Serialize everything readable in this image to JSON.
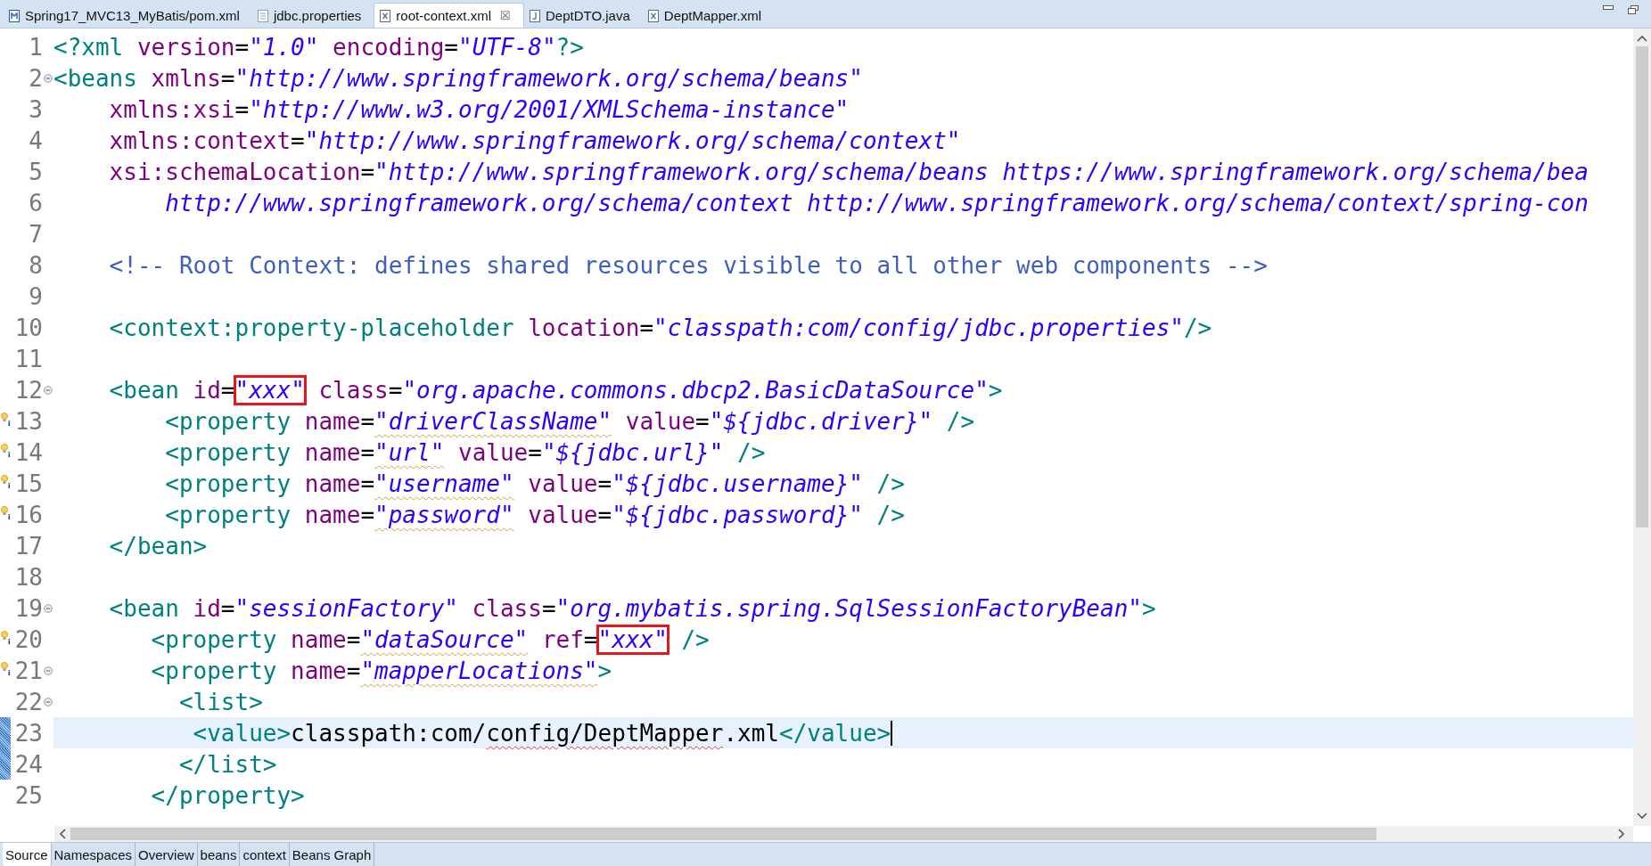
{
  "editor_tabs": [
    {
      "label": "Spring17_MVC13_MyBatis/pom.xml",
      "kind": "maven",
      "selected": false
    },
    {
      "label": "jdbc.properties",
      "kind": "text",
      "selected": false
    },
    {
      "label": "root-context.xml",
      "kind": "xml",
      "selected": true,
      "close": "☒"
    },
    {
      "label": "DeptDTO.java",
      "kind": "java",
      "selected": false
    },
    {
      "label": "DeptMapper.xml",
      "kind": "xml",
      "selected": false
    }
  ],
  "lines": [
    {
      "number": "1",
      "tokens": [
        {
          "kind": "tag",
          "text": "<?xml "
        },
        {
          "kind": "attr",
          "text": "version"
        },
        {
          "kind": "eq",
          "text": "="
        },
        {
          "kind": "value",
          "text": "\"1.0\""
        },
        {
          "kind": "attr",
          "text": " encoding"
        },
        {
          "kind": "eq",
          "text": "="
        },
        {
          "kind": "value",
          "text": "\"UTF-8\""
        },
        {
          "kind": "tag",
          "text": "?>"
        }
      ]
    },
    {
      "number": "2",
      "fold": true,
      "tokens": [
        {
          "kind": "tag",
          "text": "<beans "
        },
        {
          "kind": "attr",
          "text": "xmlns"
        },
        {
          "kind": "eq",
          "text": "="
        },
        {
          "kind": "value",
          "text": "\"http://www.springframework.org/schema/beans\""
        }
      ]
    },
    {
      "number": "3",
      "tokens": [
        {
          "kind": "attr",
          "text": "    xmlns:xsi"
        },
        {
          "kind": "eq",
          "text": "="
        },
        {
          "kind": "value",
          "text": "\"http://www.w3.org/2001/XMLSchema-instance\""
        }
      ]
    },
    {
      "number": "4",
      "tokens": [
        {
          "kind": "attr",
          "text": "    xmlns:context"
        },
        {
          "kind": "eq",
          "text": "="
        },
        {
          "kind": "value",
          "text": "\"http://www.springframework.org/schema/context\""
        }
      ]
    },
    {
      "number": "5",
      "tokens": [
        {
          "kind": "attr",
          "text": "    xsi:schemaLocation"
        },
        {
          "kind": "eq",
          "text": "="
        },
        {
          "kind": "value",
          "text": "\"http://www.springframework.org/schema/beans https://www.springframework.org/schema/bea"
        }
      ]
    },
    {
      "number": "6",
      "tokens": [
        {
          "kind": "value",
          "text": "        http://www.springframework.org/schema/context http://www.springframework.org/schema/context/spring-con"
        }
      ]
    },
    {
      "number": "7"
    },
    {
      "number": "8",
      "tokens": [
        {
          "kind": "comment",
          "text": "    <!-- Root Context: defines shared resources visible to all other web components -->"
        }
      ]
    },
    {
      "number": "9"
    },
    {
      "number": "10",
      "tokens": [
        {
          "kind": "tag",
          "text": "    <context:property-placeholder "
        },
        {
          "kind": "attr",
          "text": "location"
        },
        {
          "kind": "eq",
          "text": "="
        },
        {
          "kind": "value",
          "text": "\"classpath:com/config/jdbc.properties\""
        },
        {
          "kind": "tag",
          "text": "/>"
        }
      ]
    },
    {
      "number": "11"
    },
    {
      "number": "12",
      "fold": true,
      "tokens": [
        {
          "kind": "tag",
          "text": "    <bean "
        },
        {
          "kind": "attr",
          "text": "id"
        },
        {
          "kind": "eq",
          "text": "="
        },
        {
          "kind": "value",
          "text": "\"xxx\"",
          "boxed": true
        },
        {
          "kind": "attr",
          "text": " class"
        },
        {
          "kind": "eq",
          "text": "="
        },
        {
          "kind": "value",
          "text": "\"org.apache.commons.dbcp2.BasicDataSource\""
        },
        {
          "kind": "tag",
          "text": ">"
        }
      ]
    },
    {
      "number": "13",
      "hint": true,
      "tokens": [
        {
          "kind": "tag",
          "text": "        <property "
        },
        {
          "kind": "attr",
          "text": "name"
        },
        {
          "kind": "eq",
          "text": "="
        },
        {
          "kind": "value",
          "text": "\"driverClassName\"",
          "flagged": true
        },
        {
          "kind": "attr",
          "text": " value"
        },
        {
          "kind": "eq",
          "text": "="
        },
        {
          "kind": "value",
          "text": "\"${jdbc.driver}\""
        },
        {
          "kind": "tag",
          "text": " />"
        }
      ]
    },
    {
      "number": "14",
      "hint": true,
      "tokens": [
        {
          "kind": "tag",
          "text": "        <property "
        },
        {
          "kind": "attr",
          "text": "name"
        },
        {
          "kind": "eq",
          "text": "="
        },
        {
          "kind": "value",
          "text": "\"url\"",
          "flagged": true
        },
        {
          "kind": "attr",
          "text": " value"
        },
        {
          "kind": "eq",
          "text": "="
        },
        {
          "kind": "value",
          "text": "\"${jdbc.url}\""
        },
        {
          "kind": "tag",
          "text": " />"
        }
      ]
    },
    {
      "number": "15",
      "hint": true,
      "tokens": [
        {
          "kind": "tag",
          "text": "        <property "
        },
        {
          "kind": "attr",
          "text": "name"
        },
        {
          "kind": "eq",
          "text": "="
        },
        {
          "kind": "value",
          "text": "\"username\"",
          "flagged": true
        },
        {
          "kind": "attr",
          "text": " value"
        },
        {
          "kind": "eq",
          "text": "="
        },
        {
          "kind": "value",
          "text": "\"${jdbc.username}\""
        },
        {
          "kind": "tag",
          "text": " />"
        }
      ]
    },
    {
      "number": "16",
      "hint": true,
      "tokens": [
        {
          "kind": "tag",
          "text": "        <property "
        },
        {
          "kind": "attr",
          "text": "name"
        },
        {
          "kind": "eq",
          "text": "="
        },
        {
          "kind": "value",
          "text": "\"password\"",
          "flagged": true
        },
        {
          "kind": "attr",
          "text": " value"
        },
        {
          "kind": "eq",
          "text": "="
        },
        {
          "kind": "value",
          "text": "\"${jdbc.password}\""
        },
        {
          "kind": "tag",
          "text": " />"
        }
      ]
    },
    {
      "number": "17",
      "tokens": [
        {
          "kind": "tag",
          "text": "    </bean>"
        }
      ]
    },
    {
      "number": "18"
    },
    {
      "number": "19",
      "fold": true,
      "tokens": [
        {
          "kind": "tag",
          "text": "    <bean "
        },
        {
          "kind": "attr",
          "text": "id"
        },
        {
          "kind": "eq",
          "text": "="
        },
        {
          "kind": "value",
          "text": "\"sessionFactory\""
        },
        {
          "kind": "attr",
          "text": " class"
        },
        {
          "kind": "eq",
          "text": "="
        },
        {
          "kind": "value",
          "text": "\"org.mybatis.spring.SqlSessionFactoryBean\""
        },
        {
          "kind": "tag",
          "text": ">"
        }
      ]
    },
    {
      "number": "20",
      "hint": true,
      "tokens": [
        {
          "kind": "tag",
          "text": "       <property "
        },
        {
          "kind": "attr",
          "text": "name"
        },
        {
          "kind": "eq",
          "text": "="
        },
        {
          "kind": "value",
          "text": "\"dataSource\"",
          "flagged": true
        },
        {
          "kind": "attr",
          "text": " ref"
        },
        {
          "kind": "eq",
          "text": "="
        },
        {
          "kind": "value",
          "text": "\"xxx\"",
          "boxed": true
        },
        {
          "kind": "tag",
          "text": " />"
        }
      ]
    },
    {
      "number": "21",
      "hint": true,
      "fold": true,
      "tokens": [
        {
          "kind": "tag",
          "text": "       <property "
        },
        {
          "kind": "attr",
          "text": "name"
        },
        {
          "kind": "eq",
          "text": "="
        },
        {
          "kind": "value",
          "text": "\"mapperLocations\"",
          "flagged": true
        },
        {
          "kind": "tag",
          "text": ">"
        }
      ]
    },
    {
      "number": "22",
      "fold": true,
      "tokens": [
        {
          "kind": "tag",
          "text": "         <list>"
        }
      ]
    },
    {
      "number": "23",
      "current": true,
      "changed": true,
      "cursor": true,
      "tokens": [
        {
          "kind": "tag",
          "text": "          <value>"
        },
        {
          "kind": "text",
          "text": "classpath:com/"
        },
        {
          "kind": "text",
          "text": "config/DeptMapper",
          "flagged": true
        },
        {
          "kind": "text",
          "text": ".xml"
        },
        {
          "kind": "tag",
          "text": "</value>"
        }
      ]
    },
    {
      "number": "24",
      "changed": true,
      "tokens": [
        {
          "kind": "tag",
          "text": "         </list>"
        }
      ]
    },
    {
      "number": "25",
      "tokens": [
        {
          "kind": "tag",
          "text": "       </property>"
        }
      ]
    }
  ],
  "page_tabs": [
    {
      "label": "Source",
      "selected": true
    },
    {
      "label": "Namespaces",
      "selected": false
    },
    {
      "label": "Overview",
      "selected": false
    },
    {
      "label": "beans",
      "selected": false
    },
    {
      "label": "context",
      "selected": false
    },
    {
      "label": "Beans Graph",
      "selected": false
    }
  ]
}
